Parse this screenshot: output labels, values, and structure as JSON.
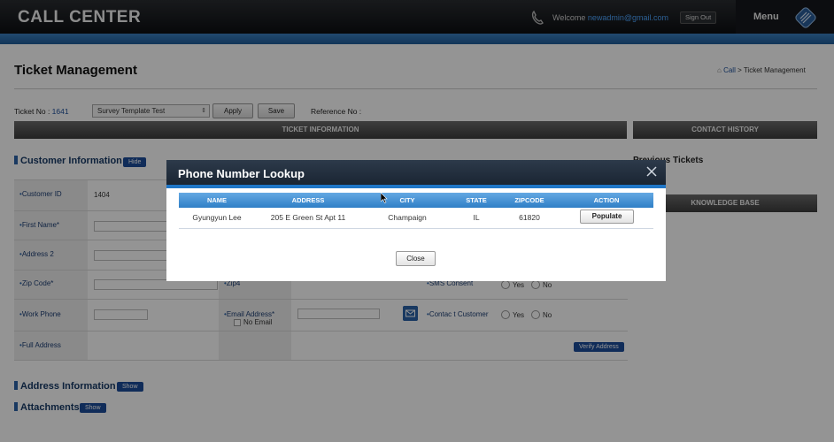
{
  "header": {
    "brand": "CALL CENTER",
    "welcome_text": "Welcome",
    "email": "newadmin@gmail.com",
    "signout": "Sign Out",
    "menu": "Menu"
  },
  "page": {
    "title": "Ticket Management",
    "breadcrumb": {
      "link": "Call",
      "sep": " > ",
      "current": "Ticket Management"
    },
    "ticket_no_label": "Ticket No : ",
    "ticket_no": "1641",
    "survey_value": "Survey Template Test",
    "apply": "Apply",
    "save": "Save",
    "reference_label": "Reference No :"
  },
  "sections": {
    "ticket_info": "TICKET INFORMATION",
    "contact_history": "CONTACT HISTORY",
    "knowledge_base": "KNOWLEDGE BASE",
    "previous_tickets": "Previous Tickets",
    "customer_info": "Customer Information",
    "hide": "Hide",
    "address_info": "Address Information",
    "attachments": "Attachments",
    "show": "Show"
  },
  "form": {
    "customer_id_label": "Customer ID",
    "customer_id": "1404",
    "first_name_label": "First Name*",
    "address2_label": "Address 2",
    "zip_label": "Zip Code*",
    "zip4_label": "Zip4",
    "sms_label": "SMS Consent",
    "work_phone_label": "Work Phone",
    "email_label": "Email Address*",
    "no_email": "No Email",
    "contact_label": "Contac t Customer",
    "yes": "Yes",
    "no": "No",
    "full_address_label": "Full Address",
    "verify_address": "Verify Address"
  },
  "modal": {
    "title": "Phone Number Lookup",
    "columns": [
      "NAME",
      "ADDRESS",
      "CITY",
      "STATE",
      "ZIPCODE",
      "ACTION"
    ],
    "rows": [
      {
        "name": "Gyungyun Lee",
        "address": "205 E Green St Apt 11",
        "city": "Champaign",
        "state": "IL",
        "zipcode": "61820",
        "action": "Populate"
      }
    ],
    "close": "Close"
  },
  "colors": {
    "header_bg": "#0d0f12",
    "accent_blue": "#1f76c7",
    "brand_blue": "#1c4f9a",
    "table_head": "#2f7fc6"
  },
  "icons": [
    "phone-icon",
    "menu-logo-icon",
    "home-icon",
    "mail-icon",
    "close-icon",
    "mouse-cursor-icon"
  ]
}
